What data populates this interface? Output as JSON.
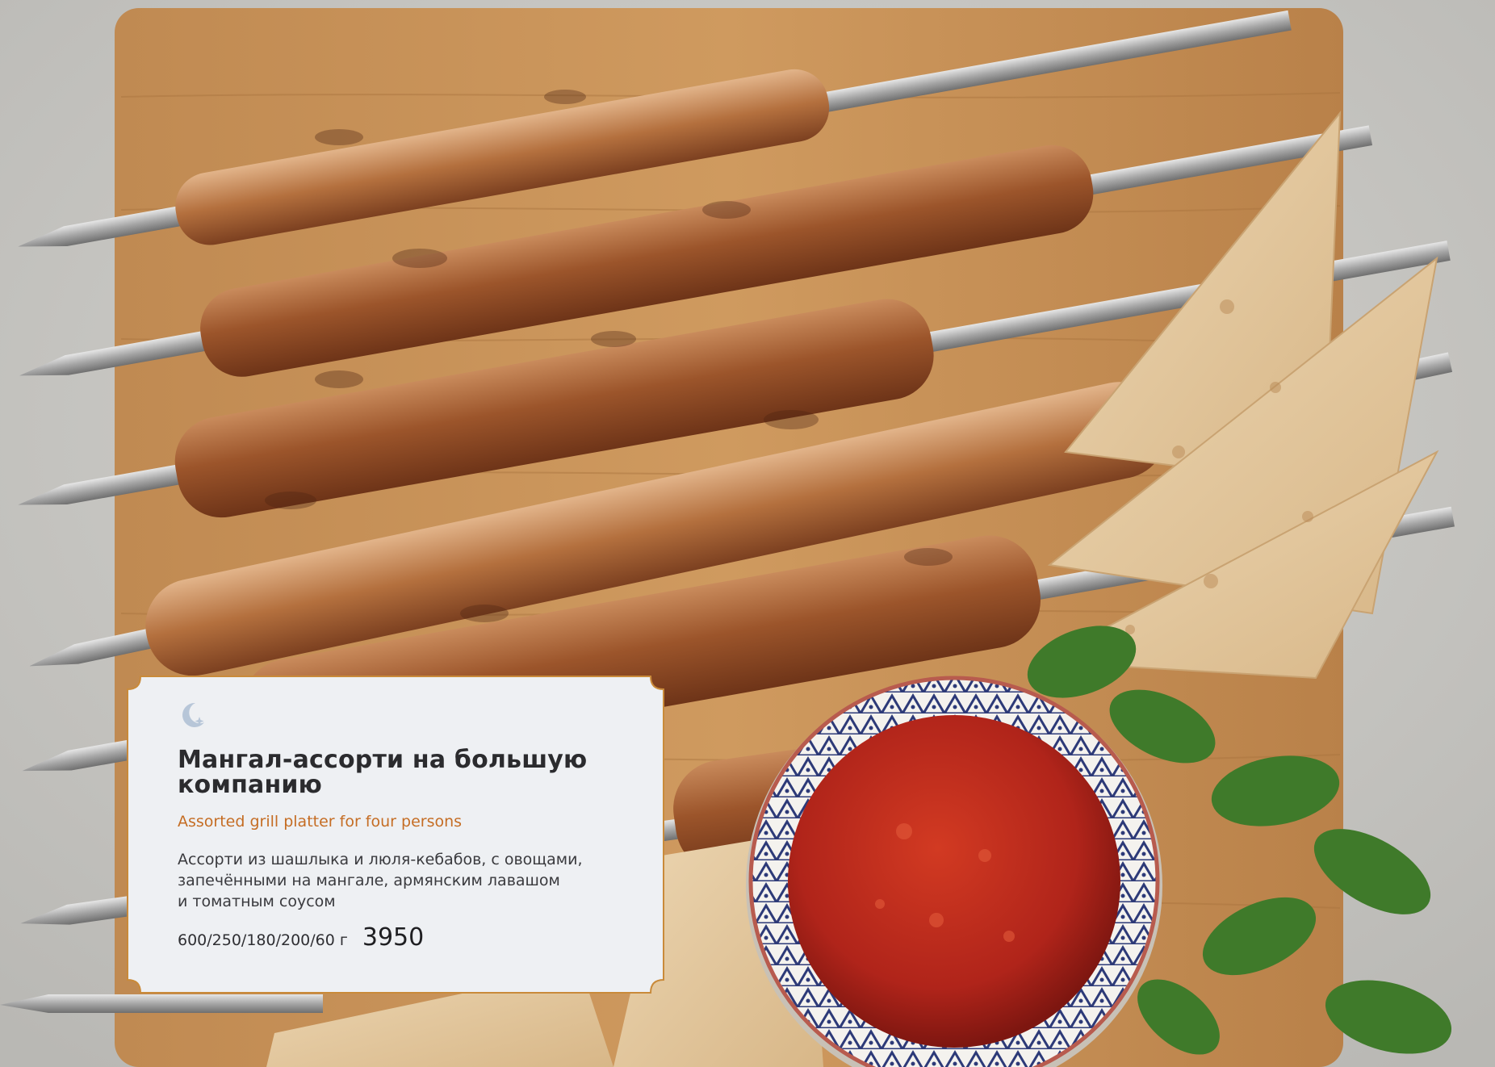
{
  "card": {
    "icon": "crescent-moon-star-icon",
    "title": "Мангал-ассорти на большую\nкомпанию",
    "subtitle": "Assorted grill platter for four persons",
    "description": "Ассорти из шашлыка и люля-кебабов, с овощами,\nзапечёнными на мангале, армянским лавашом\nи томатным соусом",
    "weight": "600/250/180/200/60 г",
    "price": "3950"
  },
  "colors": {
    "accent": "#c56d24",
    "card_background": "#eef0f3",
    "card_border": "#c98a3a",
    "icon": "#b7c6d8"
  }
}
